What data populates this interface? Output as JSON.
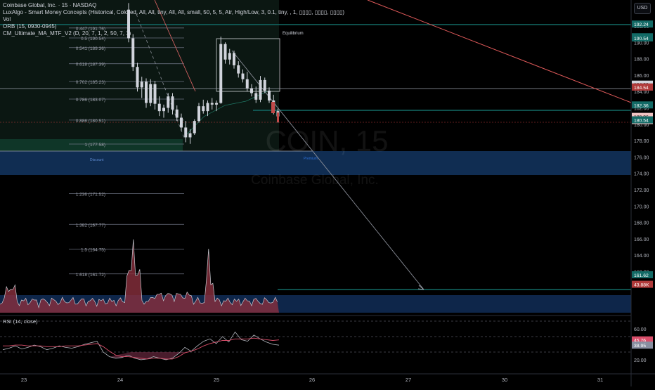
{
  "currency_button": "USD",
  "legend": {
    "title": "Coinbase Global, Inc. · 15 · NASDAQ",
    "indicator_1": "LuxAlgo - Smart Money Concepts (Historical, Colored, All, All, tiny, All, All, small, 50, 5, 5, Atr, High/Low, 3, 0.1, tiny, , 1, ▯▯▯▯, ▯▯▯▯, ▯▯▯▯)",
    "indicator_2": "Vol",
    "indicator_3": "ORB (15, 0930-0945)",
    "indicator_4": "CM_Ultimate_MA_MTF_V2 (D, 20, 7, 1, 2, 50, 7, 1)"
  },
  "watermark": {
    "symbol": "COIN, 15",
    "name": "Coinbase Global, Inc."
  },
  "chart_data": [
    {
      "type": "candlestick",
      "title": "Coinbase Global, Inc. · 15 · NASDAQ",
      "x_ticks": [
        "23",
        "24",
        "25",
        "26",
        "27",
        "30",
        "31"
      ],
      "y_ticks": [
        160.0,
        162.0,
        164.0,
        166.0,
        168.0,
        170.0,
        172.0,
        174.0,
        176.0,
        178.0,
        180.0,
        182.0,
        184.0,
        186.0,
        188.0,
        190.0,
        192.0
      ],
      "ylim": [
        160.0,
        194.8
      ],
      "fib_levels": [
        {
          "label": "0.447 (191.76)",
          "price": 191.76
        },
        {
          "label": "0.5 (190.54)",
          "price": 190.54
        },
        {
          "label": "0.541 (189.36)",
          "price": 189.36
        },
        {
          "label": "0.618 (187.39)",
          "price": 187.39
        },
        {
          "label": "0.702 (185.23)",
          "price": 185.23
        },
        {
          "label": "0.786 (183.07)",
          "price": 183.07
        },
        {
          "label": "0.886 (180.51)",
          "price": 180.51
        },
        {
          "label": "1 (177.58)",
          "price": 177.58
        },
        {
          "label": "1.236 (171.52)",
          "price": 171.52
        },
        {
          "label": "1.382 (167.77)",
          "price": 167.77
        },
        {
          "label": "1.5 (164.75)",
          "price": 164.75
        },
        {
          "label": "1.618 (161.72)",
          "price": 161.72
        }
      ],
      "zone_labels": {
        "equilibrium": "Equilibrium",
        "discount": "Discount",
        "premium": "Premium"
      },
      "price_labels": [
        {
          "text": "192.24",
          "price": 192.24,
          "color": "#136a66"
        },
        {
          "text": "190.69",
          "price": 190.69,
          "color": "#136a66"
        },
        {
          "text": "190.54",
          "price": 190.54,
          "color": "#136a66"
        },
        {
          "text": "184.90",
          "price": 184.9,
          "color": "#d1d4dc"
        },
        {
          "text": "184.55",
          "price": 184.55,
          "color": "#b03a3a"
        },
        {
          "text": "184.54",
          "price": 184.54,
          "color": "#b03a3a"
        },
        {
          "text": "182.36",
          "price": 182.36,
          "color": "#136a66"
        },
        {
          "text": "180.96",
          "price": 180.96,
          "color": "#f0c3c3"
        },
        {
          "text": "00:07",
          "price": 180.45,
          "color": "#f0c3c3"
        },
        {
          "text": "180.54",
          "price": 180.54,
          "color": "#136a66"
        },
        {
          "text": "161.62",
          "price": 161.62,
          "color": "#136a66"
        },
        {
          "text": "43.88K",
          "price": 160.45,
          "color": "#b03a3a"
        }
      ],
      "candles": [
        {
          "o": 194.0,
          "h": 194.8,
          "l": 190.0,
          "c": 190.5
        },
        {
          "o": 190.5,
          "h": 191.0,
          "l": 186.5,
          "c": 187.0
        },
        {
          "o": 187.0,
          "h": 187.5,
          "l": 184.0,
          "c": 184.5
        },
        {
          "o": 184.5,
          "h": 185.8,
          "l": 183.2,
          "c": 185.2
        },
        {
          "o": 185.2,
          "h": 185.6,
          "l": 182.0,
          "c": 182.6
        },
        {
          "o": 182.6,
          "h": 185.5,
          "l": 182.2,
          "c": 184.9
        },
        {
          "o": 184.9,
          "h": 185.3,
          "l": 181.8,
          "c": 182.5
        },
        {
          "o": 182.5,
          "h": 183.4,
          "l": 181.0,
          "c": 181.6
        },
        {
          "o": 181.6,
          "h": 182.4,
          "l": 180.8,
          "c": 182.0
        },
        {
          "o": 182.0,
          "h": 183.8,
          "l": 181.4,
          "c": 183.4
        },
        {
          "o": 183.4,
          "h": 183.8,
          "l": 181.2,
          "c": 181.8
        },
        {
          "o": 181.8,
          "h": 182.3,
          "l": 180.4,
          "c": 180.8
        },
        {
          "o": 180.8,
          "h": 181.3,
          "l": 179.2,
          "c": 179.6
        },
        {
          "o": 179.6,
          "h": 180.4,
          "l": 177.8,
          "c": 178.4
        },
        {
          "o": 178.4,
          "h": 179.4,
          "l": 177.6,
          "c": 178.9
        },
        {
          "o": 178.9,
          "h": 180.6,
          "l": 178.7,
          "c": 180.4
        },
        {
          "o": 180.4,
          "h": 182.6,
          "l": 180.2,
          "c": 182.2
        },
        {
          "o": 182.2,
          "h": 183.0,
          "l": 181.3,
          "c": 181.6
        },
        {
          "o": 181.6,
          "h": 182.9,
          "l": 181.0,
          "c": 182.6
        },
        {
          "o": 182.6,
          "h": 183.2,
          "l": 181.8,
          "c": 182.4
        },
        {
          "o": 182.4,
          "h": 182.9,
          "l": 181.6,
          "c": 182.6
        },
        {
          "o": 182.6,
          "h": 190.7,
          "l": 182.5,
          "c": 189.8
        },
        {
          "o": 189.8,
          "h": 190.0,
          "l": 187.4,
          "c": 187.9
        },
        {
          "o": 187.9,
          "h": 189.2,
          "l": 187.3,
          "c": 188.7
        },
        {
          "o": 188.7,
          "h": 189.0,
          "l": 186.8,
          "c": 187.2
        },
        {
          "o": 187.2,
          "h": 187.7,
          "l": 185.7,
          "c": 186.2
        },
        {
          "o": 186.2,
          "h": 186.7,
          "l": 185.1,
          "c": 185.5
        },
        {
          "o": 185.5,
          "h": 186.4,
          "l": 184.0,
          "c": 184.4
        },
        {
          "o": 184.4,
          "h": 184.9,
          "l": 183.4,
          "c": 183.8
        },
        {
          "o": 183.8,
          "h": 184.6,
          "l": 182.6,
          "c": 183.0
        },
        {
          "o": 183.0,
          "h": 185.9,
          "l": 182.7,
          "c": 185.4
        },
        {
          "o": 185.4,
          "h": 185.7,
          "l": 183.8,
          "c": 184.1
        },
        {
          "o": 184.1,
          "h": 184.5,
          "l": 182.6,
          "c": 182.9
        },
        {
          "o": 182.9,
          "h": 183.6,
          "l": 181.2,
          "c": 181.6
        },
        {
          "o": 181.6,
          "h": 181.9,
          "l": 180.2,
          "c": 180.96
        }
      ]
    },
    {
      "type": "line",
      "title": "RSI (14, close)",
      "y_ticks": [
        20.0,
        60.0
      ],
      "ylim": [
        14,
        70
      ],
      "levels": [
        70,
        50,
        30
      ],
      "value_labels": [
        {
          "text": "45.76",
          "value": 45.76,
          "color": "#d94e6a"
        },
        {
          "text": "38.95",
          "value": 38.95,
          "color": "#888ea0"
        }
      ],
      "series": [
        {
          "values": [
            33,
            35,
            38,
            34,
            36,
            39,
            37,
            33,
            35,
            38,
            36,
            35,
            37,
            40,
            42,
            44,
            30,
            24,
            22,
            23,
            26,
            22,
            20,
            21,
            24,
            22,
            20,
            22,
            28,
            36,
            31,
            38,
            44,
            47,
            41,
            50,
            43,
            56,
            46,
            44,
            52,
            47,
            43,
            40,
            38.95
          ]
        },
        {
          "values": [
            38,
            38,
            39,
            39,
            38,
            38,
            38,
            37,
            37,
            37,
            38,
            38,
            38,
            39,
            40,
            41,
            37,
            31,
            26,
            24,
            24,
            23,
            22,
            21,
            22,
            22,
            21,
            21,
            24,
            29,
            31,
            34,
            38,
            41,
            43,
            45,
            45,
            47,
            47,
            47,
            48,
            47,
            46,
            45,
            45.76
          ]
        }
      ]
    }
  ]
}
